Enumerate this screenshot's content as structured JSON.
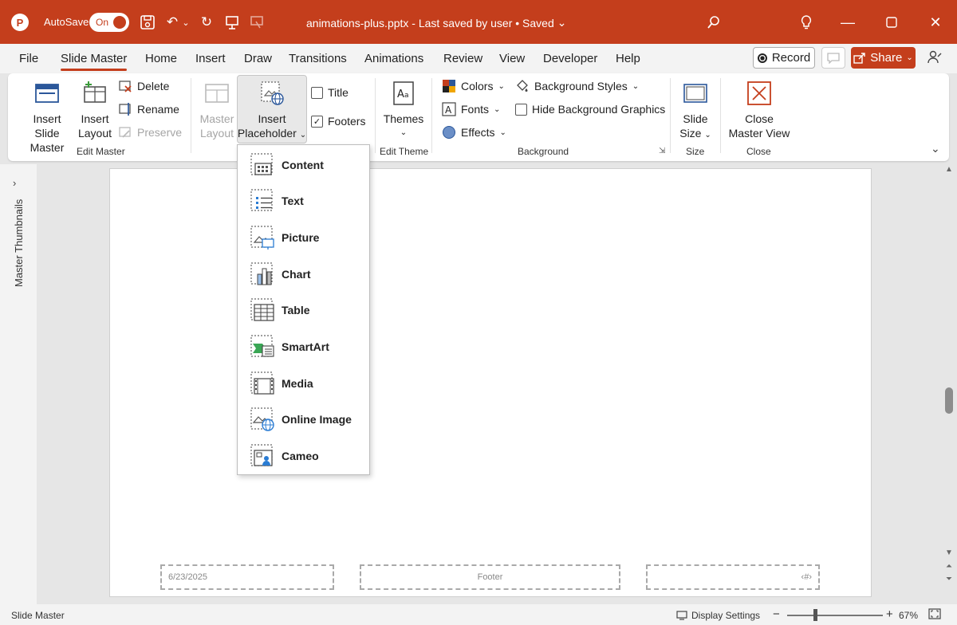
{
  "titlebar": {
    "app_logo": "P",
    "autosave_label": "AutoSave",
    "autosave_state": "On",
    "document_title": "animations-plus.pptx  -  Last saved by user  •  Saved",
    "title_chevron": "⌄",
    "icons": [
      "save-icon",
      "undo-icon",
      "redo-icon",
      "present-icon",
      "touch-icon",
      "search-icon",
      "lightbulb-icon"
    ]
  },
  "menu": {
    "tabs": [
      "File",
      "Slide Master",
      "Home",
      "Insert",
      "Draw",
      "Transitions",
      "Animations",
      "Review",
      "View",
      "Developer",
      "Help"
    ],
    "active_tab": "Slide Master",
    "record_label": "Record",
    "share_label": "Share"
  },
  "ribbon": {
    "edit_master": {
      "insert_slide_master": [
        "Insert Slide",
        "Master"
      ],
      "insert_layout": [
        "Insert",
        "Layout"
      ],
      "delete": "Delete",
      "rename": "Rename",
      "preserve": "Preserve",
      "label": "Edit Master"
    },
    "master_layout": {
      "master_layout": [
        "Master",
        "Layout"
      ],
      "insert_placeholder": [
        "Insert",
        "Placeholder"
      ],
      "title": "Title",
      "title_checked": false,
      "footers": "Footers",
      "footers_checked": true
    },
    "edit_theme": {
      "themes": "Themes",
      "label": "Edit Theme"
    },
    "background": {
      "colors": "Colors",
      "fonts": "Fonts",
      "effects": "Effects",
      "background_styles": "Background Styles",
      "hide_background_graphics": "Hide Background Graphics",
      "label": "Background"
    },
    "size": {
      "slide_size": [
        "Slide",
        "Size"
      ],
      "label": "Size"
    },
    "close": {
      "close_master_view": [
        "Close",
        "Master View"
      ],
      "label": "Close"
    }
  },
  "dropdown": {
    "items": [
      {
        "label": "Content",
        "icon": "content-placeholder-icon"
      },
      {
        "label": "Text",
        "icon": "text-placeholder-icon"
      },
      {
        "label": "Picture",
        "icon": "picture-placeholder-icon"
      },
      {
        "label": "Chart",
        "icon": "chart-placeholder-icon"
      },
      {
        "label": "Table",
        "icon": "table-placeholder-icon"
      },
      {
        "label": "SmartArt",
        "icon": "smartart-placeholder-icon"
      },
      {
        "label": "Media",
        "icon": "media-placeholder-icon"
      },
      {
        "label": "Online Image",
        "icon": "online-image-placeholder-icon"
      },
      {
        "label": "Cameo",
        "icon": "cameo-placeholder-icon"
      }
    ]
  },
  "left_pane": {
    "label": "Master Thumbnails"
  },
  "slide": {
    "date": "6/23/2025",
    "footer": "Footer",
    "slide_number": "‹#›"
  },
  "status": {
    "mode": "Slide Master",
    "display_settings": "Display Settings",
    "zoom_out": "−",
    "zoom_in": "+",
    "zoom": "67%"
  },
  "colors": {
    "accent": "#c43e1c",
    "ribbon_bg": "#ffffff",
    "app_bg": "#e6e6e6"
  }
}
